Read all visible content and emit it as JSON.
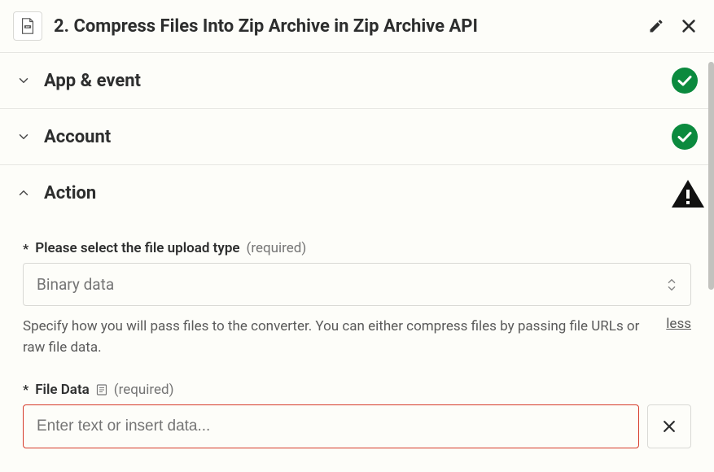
{
  "header": {
    "title": "2. Compress Files Into Zip Archive in Zip Archive API"
  },
  "sections": {
    "appEvent": {
      "title": "App & event"
    },
    "account": {
      "title": "Account"
    },
    "action": {
      "title": "Action"
    }
  },
  "fields": {
    "uploadType": {
      "label": "Please select the file upload type",
      "required": "(required)",
      "value": "Binary data",
      "help": "Specify how you will pass files to the converter. You can either compress files by passing file URLs or raw file data.",
      "lessLabel": "less"
    },
    "fileData": {
      "label": "File Data",
      "required": "(required)",
      "placeholder": "Enter text or insert data..."
    }
  }
}
